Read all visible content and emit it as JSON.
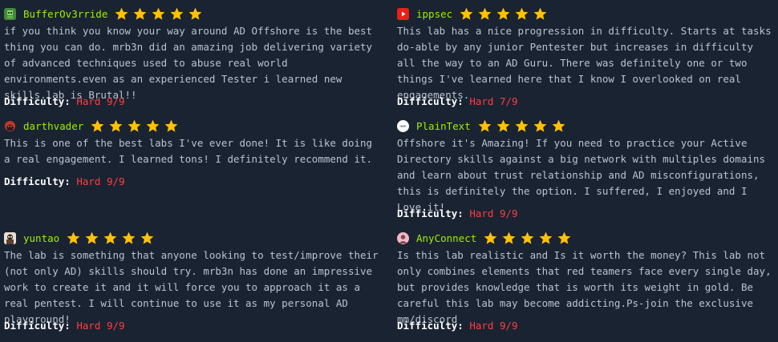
{
  "colors": {
    "background": "#1a2332",
    "username": "#9fef00",
    "text": "#b9c3d2",
    "difficulty_value": "#ff3e3e",
    "star": "#ffc107"
  },
  "reviews": [
    {
      "username": "BufferOv3rride",
      "avatar_icon": "green-robot-avatar-icon",
      "rating": 5,
      "text": "if you think you know your way around AD Offshore is the best thing you can do. mrb3n did an amazing job delivering variety of advanced techniques used to abuse real world environments.even as an experienced Tester i learned new skills.lab is Brutal!!",
      "difficulty_label": "Difficulty:",
      "difficulty_value": "Hard 9/9"
    },
    {
      "username": "ippsec",
      "avatar_icon": "youtube-avatar-icon",
      "rating": 5,
      "text": "This lab has a nice progression in difficulty. Starts at tasks do-able by any junior Pentester but increases in difficulty all the way to an AD Guru. There was definitely one or two things I've learned here that I know I overlooked on real engagements.",
      "difficulty_label": "Difficulty:",
      "difficulty_value": "Hard 7/9"
    },
    {
      "username": "darthvader",
      "avatar_icon": "darthvader-avatar-icon",
      "rating": 5,
      "text": "This is one of the best labs I've ever done! It is like doing a real engagement. I learned tons! I definitely recommend it.",
      "difficulty_label": "Difficulty:",
      "difficulty_value": "Hard 9/9"
    },
    {
      "username": "PlainText",
      "avatar_icon": "plaintext-avatar-icon",
      "rating": 5,
      "text": "Offshore it's Amazing! If you need to practice your Active Directory skills against a big network with multiples domains and learn about trust relationship and AD misconfigurations, this is definitely the option. I suffered, I enjoyed and I Love it!",
      "difficulty_label": "Difficulty:",
      "difficulty_value": "Hard 9/9"
    },
    {
      "username": "yuntao",
      "avatar_icon": "yuntao-avatar-icon",
      "rating": 5,
      "text": "The lab is something that anyone looking to test/improve their (not only AD) skills should try. mrb3n has done an impressive work to create it and it will force you to approach it as a real pentest. I will continue to use it as my personal AD playground!",
      "difficulty_label": "Difficulty:",
      "difficulty_value": "Hard 9/9"
    },
    {
      "username": "AnyConnect",
      "avatar_icon": "anyconnect-avatar-icon",
      "rating": 5,
      "text": "Is this lab realistic and Is it worth the money? This lab not only combines elements that red teamers face every single day, but provides knowledge that is worth its weight in gold. Be careful this lab may become addicting.Ps-join the exclusive mm/discord",
      "difficulty_label": "Difficulty:",
      "difficulty_value": "Hard 9/9"
    }
  ]
}
